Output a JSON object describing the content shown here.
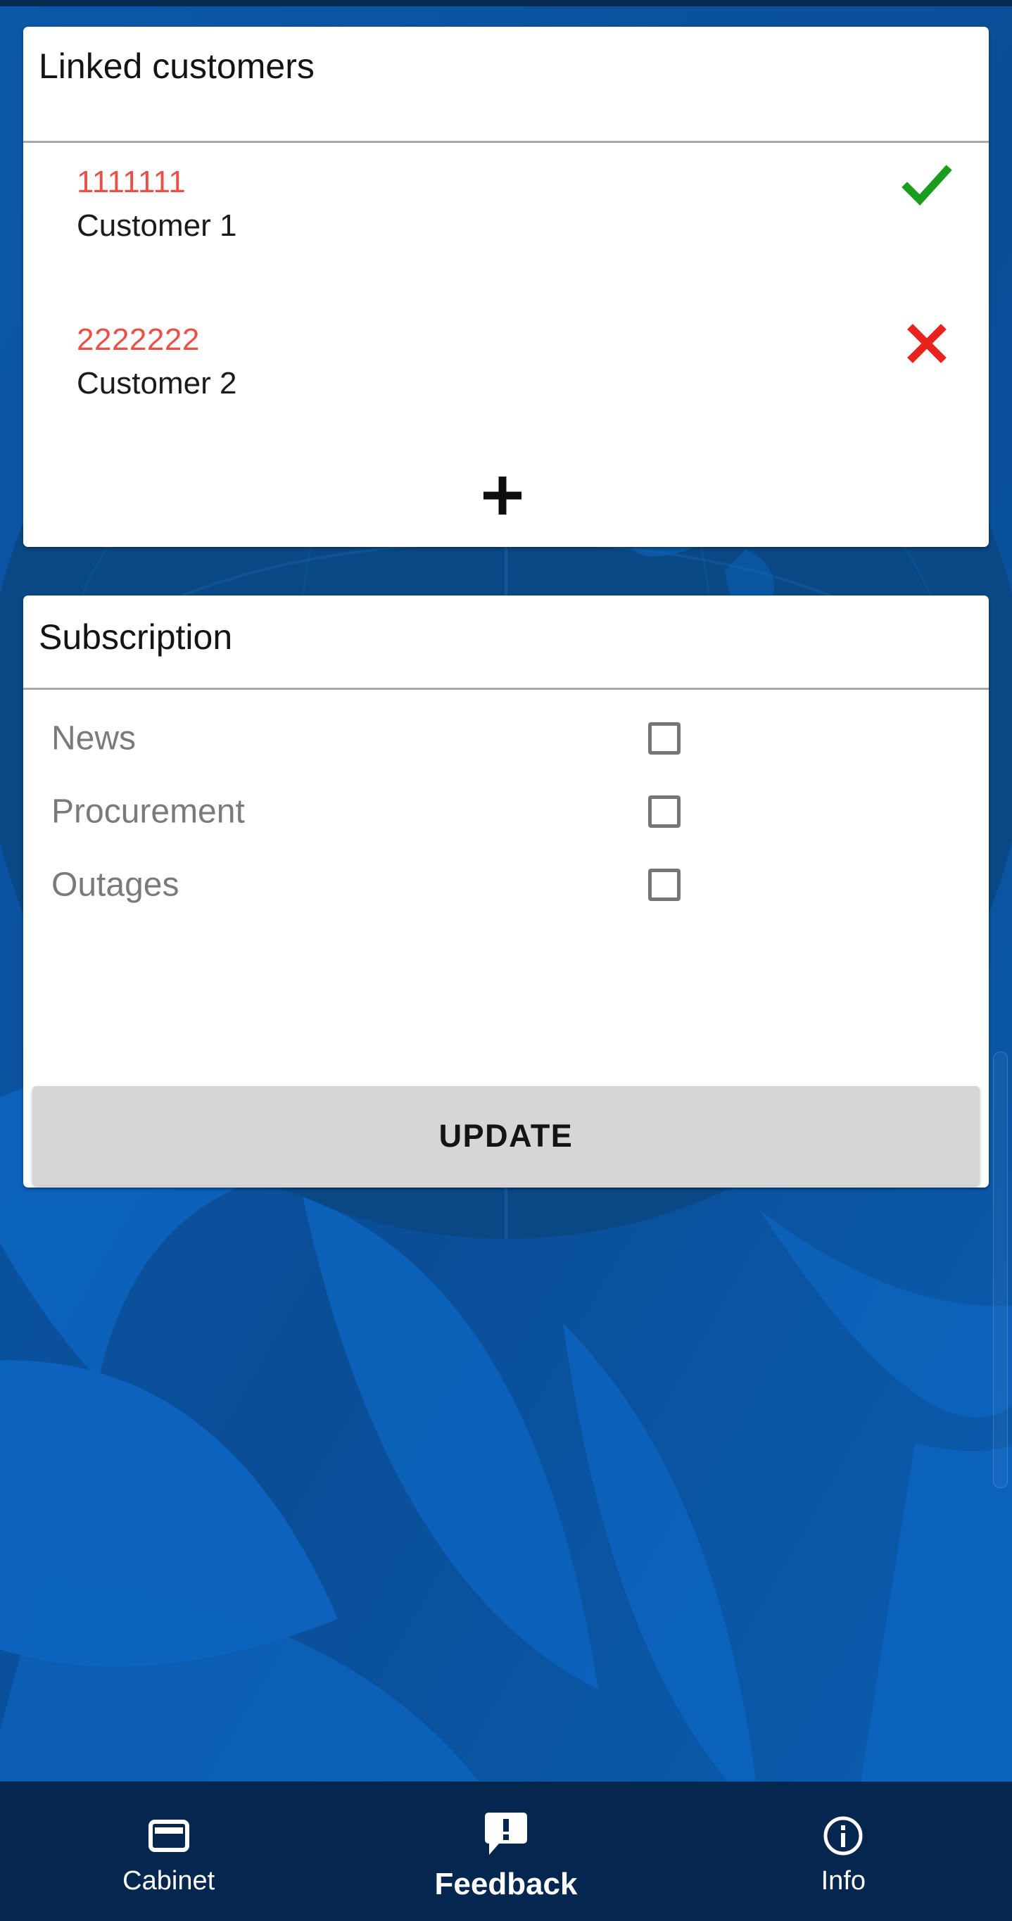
{
  "theme": {
    "background_blue": "#0b55a3",
    "background_blue_dark": "#0a4883",
    "nav_bar_navy": "#05264f",
    "status_strip": "#06294f",
    "card_white": "#ffffff",
    "divider_gray": "#a8a8a8",
    "customer_id_red": "#ea5046",
    "check_green": "#1a9c1d",
    "cross_red": "#e8231c",
    "checkbox_gray": "#767676",
    "label_gray": "#7a7a7a",
    "update_button_gray": "#d6d6d6"
  },
  "linked_customers_card": {
    "title": "Linked customers",
    "add_icon": "plus-icon",
    "rows": [
      {
        "id": "1111111",
        "name": "Customer 1",
        "status_icon": "check-icon",
        "status": "linked"
      },
      {
        "id": "2222222",
        "name": "Customer 2",
        "status_icon": "cross-icon",
        "status": "not-linked"
      }
    ]
  },
  "subscription_card": {
    "title": "Subscription",
    "rows": [
      {
        "label": "News",
        "checked": false
      },
      {
        "label": "Procurement",
        "checked": false
      },
      {
        "label": "Outages",
        "checked": false
      }
    ],
    "update_label": "UPDATE"
  },
  "bottom_nav": {
    "items": [
      {
        "label": "Cabinet",
        "icon": "card-icon",
        "active": false
      },
      {
        "label": "Feedback",
        "icon": "speech-bubble-alert-icon",
        "active": true
      },
      {
        "label": "Info",
        "icon": "info-circle-icon",
        "active": false
      }
    ]
  }
}
